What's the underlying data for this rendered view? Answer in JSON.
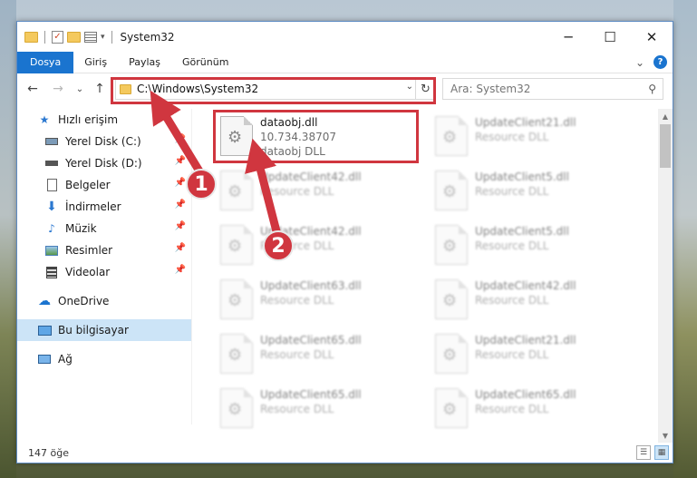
{
  "window": {
    "title": "System32",
    "controls": {
      "minimize": "─",
      "maximize": "☐",
      "close": "✕"
    }
  },
  "ribbon": {
    "tabs": [
      "Dosya",
      "Giriş",
      "Paylaş",
      "Görünüm"
    ],
    "active_tab": "Dosya",
    "expand_glyph": "⌄",
    "help_glyph": "?"
  },
  "navigation": {
    "back": "←",
    "forward": "→",
    "recent": "⌄",
    "up": "↑",
    "address": "C:\\Windows\\System32",
    "dropdown": "⌄",
    "refresh": "↻",
    "search_placeholder": "Ara: System32",
    "search_glyph": "⚲"
  },
  "sidebar": {
    "quick_access": "Hızlı erişim",
    "items": [
      {
        "label": "Yerel Disk (C:)",
        "icon": "drive-icon",
        "pinned": true
      },
      {
        "label": "Yerel Disk (D:)",
        "icon": "drive-icon",
        "pinned": true
      },
      {
        "label": "Belgeler",
        "icon": "documents-icon",
        "pinned": true
      },
      {
        "label": "İndirmeler",
        "icon": "downloads-icon",
        "pinned": true
      },
      {
        "label": "Müzik",
        "icon": "music-icon",
        "pinned": true
      },
      {
        "label": "Resimler",
        "icon": "pictures-icon",
        "pinned": true
      },
      {
        "label": "Videolar",
        "icon": "videos-icon",
        "pinned": true
      }
    ],
    "onedrive": "OneDrive",
    "this_pc": "Bu bilgisayar",
    "network": "Ağ"
  },
  "files": {
    "highlighted": {
      "name": "dataobj.dll",
      "version": "10.734.38707",
      "description": "dataobj DLL"
    },
    "left_column": [
      {
        "name": "UpdateClient42.dll",
        "type": "Resource DLL"
      },
      {
        "name": "UpdateClient42.dll",
        "type": "Resource DLL"
      },
      {
        "name": "UpdateClient63.dll",
        "type": "Resource DLL"
      },
      {
        "name": "UpdateClient65.dll",
        "type": "Resource DLL"
      },
      {
        "name": "UpdateClient65.dll",
        "type": "Resource DLL"
      }
    ],
    "right_column": [
      {
        "name": "UpdateClient21.dll",
        "type": "Resource DLL"
      },
      {
        "name": "UpdateClient5.dll",
        "type": "Resource DLL"
      },
      {
        "name": "UpdateClient5.dll",
        "type": "Resource DLL"
      },
      {
        "name": "UpdateClient42.dll",
        "type": "Resource DLL"
      },
      {
        "name": "UpdateClient21.dll",
        "type": "Resource DLL"
      },
      {
        "name": "UpdateClient65.dll",
        "type": "Resource DLL"
      }
    ]
  },
  "status": {
    "item_count": "147 öğe"
  },
  "callouts": {
    "step1": "1",
    "step2": "2",
    "color": "#d0363f"
  }
}
